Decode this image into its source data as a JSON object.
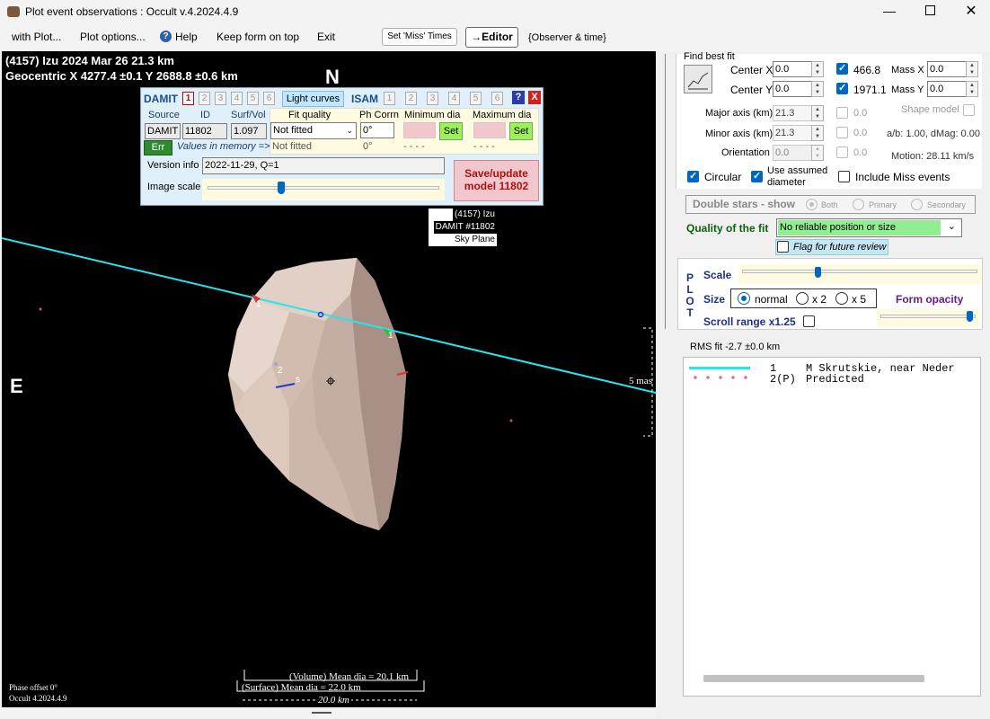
{
  "window": {
    "title": "Plot event observations : Occult v.4.2024.4.9"
  },
  "menu": {
    "with_plot": "with Plot...",
    "plot_options": "Plot options...",
    "help": "Help",
    "keep_form": "Keep form on top",
    "exit": "Exit",
    "set_miss": "Set 'Miss' Times",
    "editor": "→Editor",
    "observer_time": "{Observer & time}"
  },
  "plot": {
    "header_line1": "(4157) Izu  2024 Mar 26   21.3 km",
    "header_line2": "Geocentric  X  4277.4 ±0.1  Y 2688.8 ±0.6 km",
    "north": "N",
    "east": "E",
    "chord1_label": "1",
    "chord2_label": "2",
    "s_label": "s",
    "scale_label": "5 mas",
    "info_box": [
      "(4157) Izu",
      "DAMIT #11802",
      "Sky Plane"
    ],
    "volume_dia": "(Volume) Mean dia = 20.1 km",
    "surface_dia": "(Surface) Mean dia = 22.0 km",
    "scalebar": "20.0 km",
    "phase_offset": "Phase offset 0°",
    "version": "Occult 4.2024.4.9"
  },
  "damit": {
    "title": "DAMIT",
    "tabs": [
      "1",
      "2",
      "3",
      "4",
      "5",
      "6"
    ],
    "light_curves": "Light curves",
    "isam": "ISAM",
    "isam_tabs": [
      "1",
      "2",
      "3",
      "4",
      "5",
      "6"
    ],
    "help_btn": "?",
    "close_btn": "X",
    "source_label": "Source",
    "id_label": "ID",
    "surfvol_label": "Surf/Vol",
    "source": "DAMIT",
    "id": "11802",
    "surfvol": "1.097",
    "fit_quality_label": "Fit quality",
    "fit_quality": "Not fitted",
    "fit_quality2": "Not fitted",
    "ph_corrn_label": "Ph Corrn",
    "ph_corrn": "0°",
    "ph_corrn2": "0°",
    "min_dia_label": "Minimum dia",
    "max_dia_label": "Maximum dia",
    "set": "Set",
    "dashes": "- - - -",
    "err": "Err",
    "values_mem": "Values in memory =>",
    "version_info_label": "Version info",
    "version_info": "2022-11-29, Q=1",
    "image_scale_label": "Image scale",
    "save_btn_l1": "Save/update",
    "save_btn_l2": "model 11802"
  },
  "fit": {
    "find_best_fit": "Find best fit",
    "center_x_label": "Center X",
    "center_x": "0.0",
    "center_y_label": "Center Y",
    "center_y": "0.0",
    "v466": "466.8",
    "v1971": "1971.1",
    "mass_x_label": "Mass X",
    "mass_x": "0.0",
    "mass_y_label": "Mass Y",
    "mass_y": "0.0",
    "major_label": "Major axis (km)",
    "major": "21.3",
    "minor_label": "Minor axis (km)",
    "minor": "21.3",
    "orient_label": "Orientation",
    "orient": "0.0",
    "zero": "0.0",
    "shape_model": "Shape model",
    "ab": "a/b: 1.00, dMag: 0.00",
    "motion": "Motion: 28.11 km/s",
    "circular": "Circular",
    "use_assumed1": "Use assumed",
    "use_assumed2": "diameter",
    "include_miss": "Include Miss events",
    "double_stars": "Double stars - show",
    "both": "Both",
    "primary": "Primary",
    "secondary": "Secondary",
    "quality_label": "Quality of the fit",
    "quality_value": "No reliable position or size",
    "flag_review": "Flag for future review"
  },
  "plotpanel": {
    "plot_letters": [
      "P",
      "L",
      "O",
      "T"
    ],
    "scale": "Scale",
    "size": "Size",
    "normal": "normal",
    "x2": "x 2",
    "x5": "x 5",
    "form_opacity": "Form opacity",
    "scroll_range": "Scroll range x1.25"
  },
  "results": {
    "rms": "RMS fit -2.7 ±0.0 km",
    "row1_num": "1",
    "row1_text": "M Skrutskie, near Neder",
    "row2_num": "2(P)",
    "row2_text": "Predicted"
  },
  "colors": {
    "chord": "#22e6f0",
    "accent": "#0067c0",
    "save_btn": "#f2c6cd",
    "quality_bg": "#90ee90"
  }
}
